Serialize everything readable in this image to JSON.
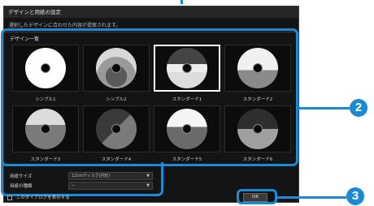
{
  "dialog": {
    "title": "デザインと用紙の設定",
    "subtitle": "選択したデザインに合わせた内容が提案されます。",
    "list_label": "デザイン一覧"
  },
  "designs": [
    {
      "label": "シンプル1",
      "style": "simple1"
    },
    {
      "label": "シンプル2",
      "style": "simple2"
    },
    {
      "label": "スタンダード1",
      "style": "std1",
      "selected": true
    },
    {
      "label": "スタンダード2",
      "style": "std2"
    },
    {
      "label": "スタンダード3",
      "style": "std3"
    },
    {
      "label": "スタンダード4",
      "style": "std4"
    },
    {
      "label": "スタンダード5",
      "style": "std5"
    },
    {
      "label": "スタンダード6",
      "style": "std6"
    }
  ],
  "paper": {
    "size_label": "用紙サイズ",
    "size_value": "12cmディスク(円形)",
    "type_label": "用紙の種類",
    "type_value": "─"
  },
  "bottom_checkbox_label": "このダイアログを表示する",
  "ok_label": "OK",
  "callouts": {
    "panel": "2",
    "ok": "3"
  },
  "colors": {
    "accent": "#1a8ad4",
    "dialog_bg": "#141414"
  }
}
